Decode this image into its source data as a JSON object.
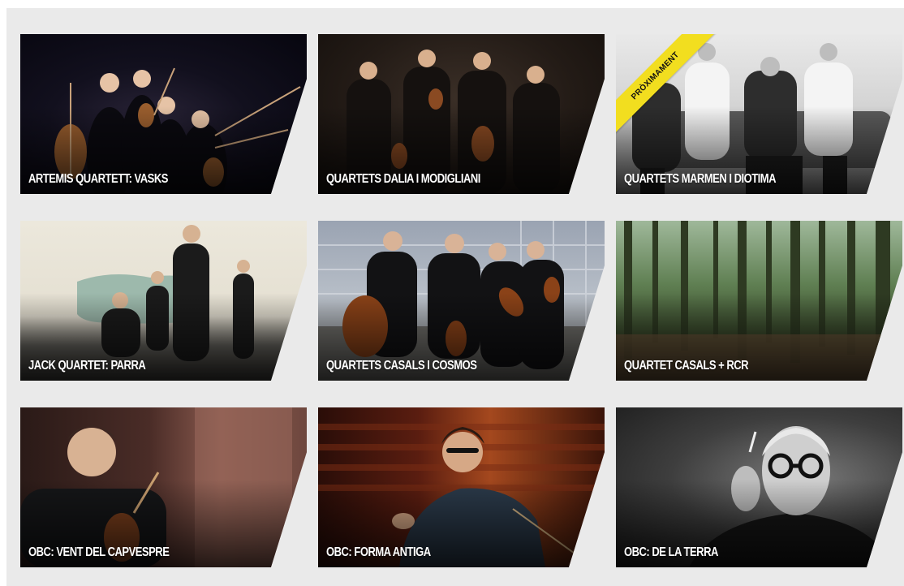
{
  "cards": [
    {
      "title": "ARTEMIS QUARTETT: VASKS",
      "image": "artemis-quartett-photo"
    },
    {
      "title": "QUARTETS DALIA I MODIGLIANI",
      "image": "dalia-modigliani-photo"
    },
    {
      "title": "QUARTETS MARMEN I DIOTIMA",
      "image": "marmen-diotima-photo",
      "badge": "PRÒXIMAMENT"
    },
    {
      "title": "JACK QUARTET: PARRA",
      "image": "jack-quartet-photo"
    },
    {
      "title": "QUARTETS CASALS I COSMOS",
      "image": "casals-cosmos-photo"
    },
    {
      "title": "QUARTET CASALS + RCR",
      "image": "forest-photo"
    },
    {
      "title": "OBC: VENT DEL CAPVESPRE",
      "image": "violinist-photo"
    },
    {
      "title": "OBC: FORMA ANTIGA",
      "image": "conductor-photo"
    },
    {
      "title": "OBC: DE LA TERRA",
      "image": "composer-photo"
    }
  ],
  "colors": {
    "background": "#eaeaea",
    "badge": "#f2de1f",
    "title_text": "#ffffff"
  }
}
